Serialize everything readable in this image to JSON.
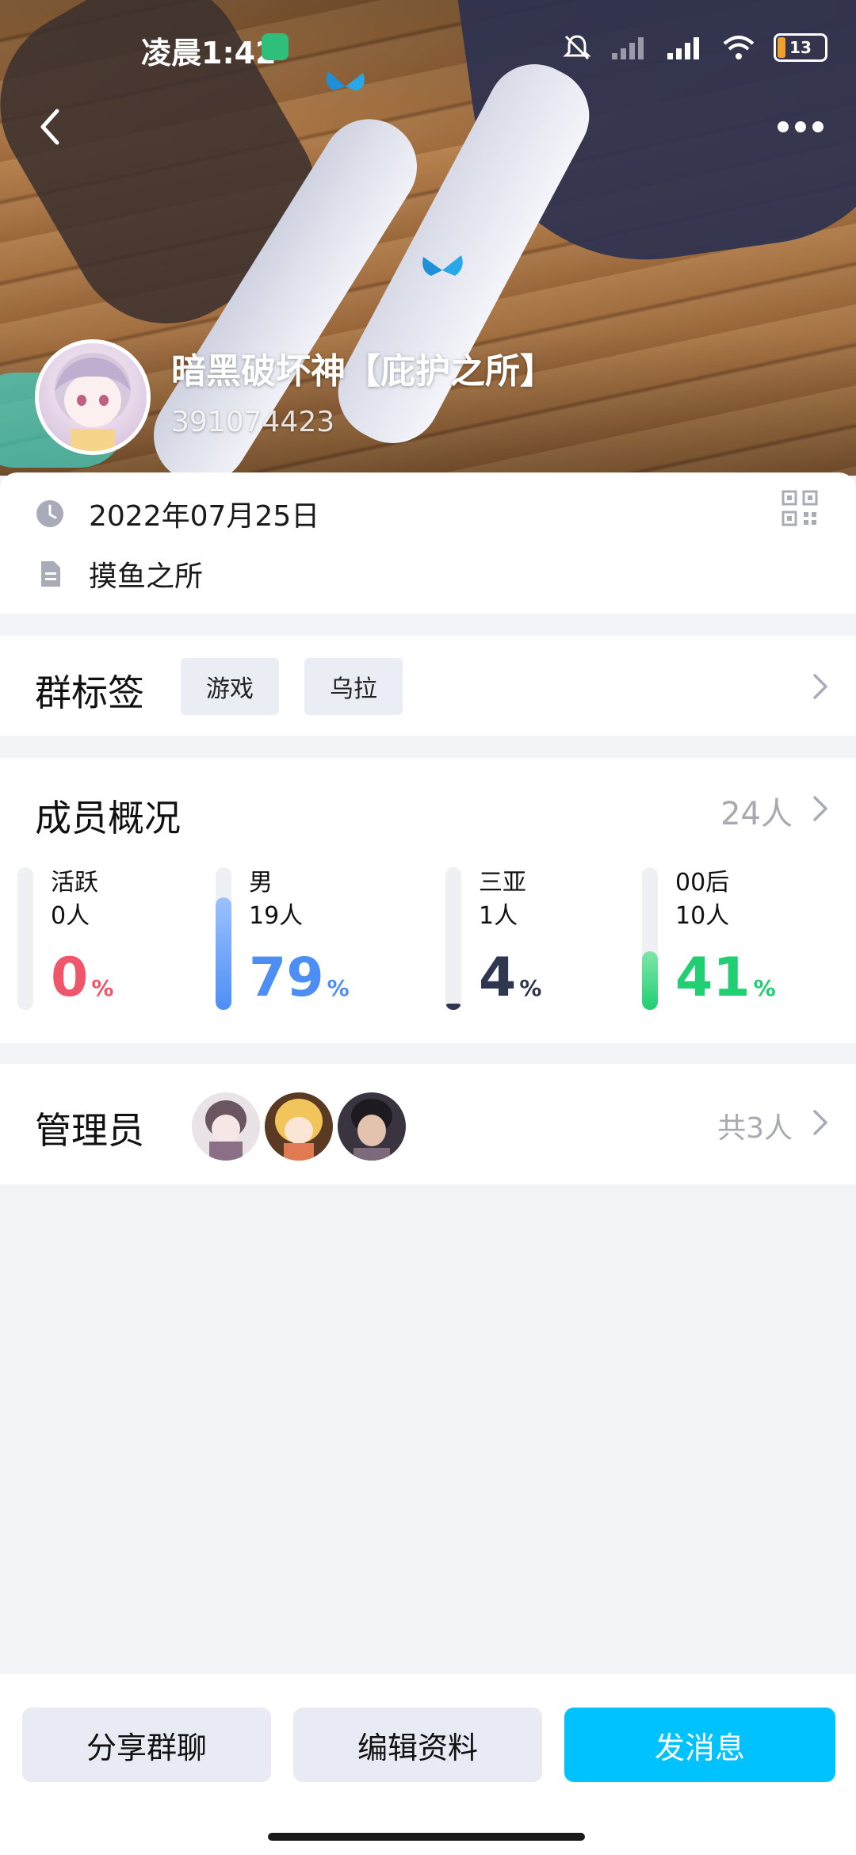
{
  "status_bar": {
    "time": "凌晨1:42",
    "battery": "13"
  },
  "group": {
    "name": "暗黑破坏神【庇护之所】",
    "id": "391074423",
    "created_date": "2022年07月25日",
    "description": "摸鱼之所"
  },
  "tags_section": {
    "title": "群标签",
    "tags": [
      "游戏",
      "乌拉"
    ]
  },
  "members_section": {
    "title": "成员概况",
    "count": "24人",
    "stats": [
      {
        "label": "活跃",
        "count": "0人",
        "percent": "0",
        "percent_sign": "%",
        "fill": 0.0,
        "color": "#f0566b"
      },
      {
        "label": "男",
        "count": "19人",
        "percent": "79",
        "percent_sign": "%",
        "fill": 0.79,
        "color": "#4d8ef5"
      },
      {
        "label": "三亚",
        "count": "1人",
        "percent": "4",
        "percent_sign": "%",
        "fill": 0.04,
        "color": "#2f3650"
      },
      {
        "label": "00后",
        "count": "10人",
        "percent": "41",
        "percent_sign": "%",
        "fill": 0.41,
        "color": "#1fcf72"
      }
    ]
  },
  "admins_section": {
    "title": "管理员",
    "total": "共3人"
  },
  "bottom_bar": {
    "share_label": "分享群聊",
    "edit_label": "编辑资料",
    "message_label": "发消息"
  }
}
